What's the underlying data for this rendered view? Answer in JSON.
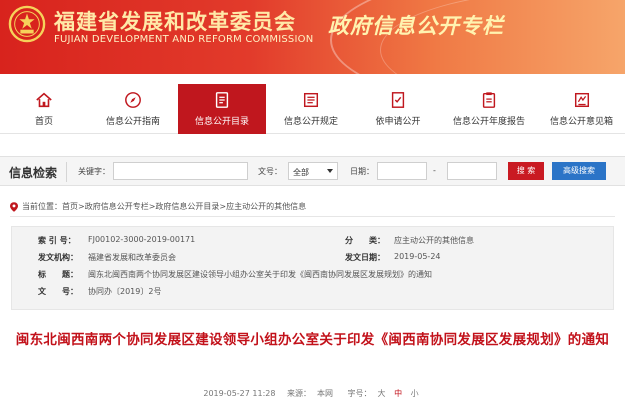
{
  "header": {
    "org_name_cn": "福建省发展和改革委员会",
    "org_name_en": "FUJIAN DEVELOPMENT AND REFORM COMMISSION",
    "section_title": "政府信息公开专栏",
    "colors": {
      "banner_red": "#d8231d",
      "accent_red": "#c0171e",
      "title_gold": "#ffe9a8"
    }
  },
  "nav": {
    "items": [
      {
        "label": "首页",
        "icon": "home-icon"
      },
      {
        "label": "信息公开指南",
        "icon": "compass-icon"
      },
      {
        "label": "信息公开目录",
        "icon": "catalog-icon",
        "active": true
      },
      {
        "label": "信息公开规定",
        "icon": "regulation-icon"
      },
      {
        "label": "依申请公开",
        "icon": "apply-icon"
      },
      {
        "label": "信息公开年度报告",
        "icon": "report-icon"
      },
      {
        "label": "信息公开意见箱",
        "icon": "opinion-box-icon"
      }
    ]
  },
  "search": {
    "title": "信息检索",
    "keyword_label": "关键字：",
    "keyword_value": "",
    "doc_no_label": "文号：",
    "doc_no_value": "全部",
    "date_label": "日期：",
    "date_from": "",
    "date_sep": "-",
    "date_to": "",
    "search_button": "搜 索",
    "advanced_button": "高级搜索"
  },
  "breadcrumb": {
    "prefix": "当前位置：",
    "items": [
      "首页",
      "政府信息公开专栏",
      "政府信息公开目录",
      "应主动公开的其他信息"
    ],
    "separator": " > "
  },
  "meta": {
    "index_label": "索 引 号：",
    "index_value": "FJ00102-3000-2019-00171",
    "category_label": "分　　类：",
    "category_value": "应主动公开的其他信息",
    "issuer_label": "发文机构：",
    "issuer_value": "福建省发展和改革委员会",
    "date_label": "发文日期：",
    "date_value": "2019-05-24",
    "title_label": "标　　题：",
    "title_value": "闽东北闽西南两个协同发展区建设领导小组办公室关于印发《闽西南协同发展区发展规划》的通知",
    "docno_label": "文　　号：",
    "docno_value": "协同办〔2019〕2号"
  },
  "article": {
    "title": "闽东北闽西南两个协同发展区建设领导小组办公室关于印发《闽西南协同发展区发展规划》的通知",
    "timestamp": "2019-05-27 11:28",
    "source_label": "来源：",
    "source_value": "本网",
    "font_size_label": "字号：",
    "font_large": "大",
    "font_medium": "中",
    "font_small": "小"
  }
}
